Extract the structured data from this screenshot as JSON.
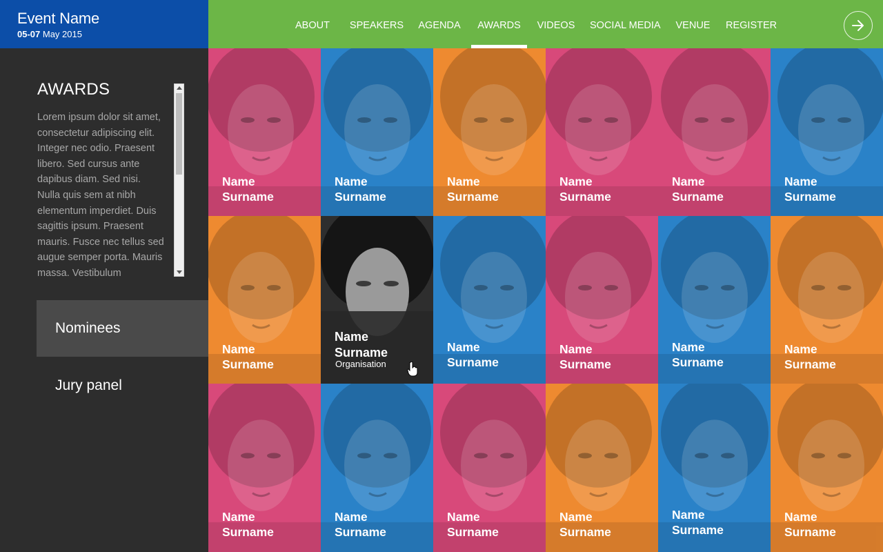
{
  "header": {
    "event_name": "Event Name",
    "date_bold": "05-07",
    "date_rest": " May 2015",
    "brand_color": "#0c4ea8",
    "bar_color": "#6cb647"
  },
  "nav": {
    "items": [
      {
        "label": "ABOUT"
      },
      {
        "label": "SPEAKERS"
      },
      {
        "label": "AGENDA"
      },
      {
        "label": "AWARDS",
        "active": true
      },
      {
        "label": "VIDEOS"
      },
      {
        "label": "SOCIAL MEDIA"
      },
      {
        "label": "VENUE"
      },
      {
        "label": "REGISTER"
      }
    ],
    "next_icon": "arrow-right-icon"
  },
  "sidebar": {
    "title": "AWARDS",
    "text": "Lorem ipsum dolor sit amet, consectetur adipiscing elit. Integer nec odio. Praesent libero. Sed cursus ante dapibus diam. Sed nisi. Nulla quis sem at nibh elementum imperdiet. Duis sagittis ipsum. Praesent mauris. Fusce nec tellus sed augue semper porta. Mauris massa. Vestibulum",
    "menu": [
      {
        "label": "Nominees",
        "selected": true
      },
      {
        "label": "Jury panel",
        "selected": false
      }
    ]
  },
  "colors": {
    "pink": "#d8497a",
    "blue": "#2a82c8",
    "orange": "#ee8a30"
  },
  "grid": {
    "tiles": [
      {
        "first": "Name",
        "last": "Surname",
        "color": "#d8497a"
      },
      {
        "first": "Name",
        "last": "Surname",
        "color": "#2a82c8"
      },
      {
        "first": "Name",
        "last": "Surname",
        "color": "#ee8a30"
      },
      {
        "first": "Name",
        "last": "Surname",
        "color": "#d8497a"
      },
      {
        "first": "Name",
        "last": "Surname",
        "color": "#d8497a"
      },
      {
        "first": "Name",
        "last": "Surname",
        "color": "#2a82c8"
      },
      {
        "first": "Name",
        "last": "Surname",
        "color": "#ee8a30"
      },
      {
        "first": "Name",
        "last": "Surname",
        "organisation": "Organisation",
        "featured": true
      },
      {
        "first": "Name",
        "last": "Surname",
        "color": "#2a82c8"
      },
      {
        "first": "Name",
        "last": "Surname",
        "color": "#d8497a"
      },
      {
        "first": "Name",
        "last": "Surname",
        "color": "#2a82c8"
      },
      {
        "first": "Name",
        "last": "Surname",
        "color": "#ee8a30"
      },
      {
        "first": "Name",
        "last": "Surname",
        "color": "#d8497a"
      },
      {
        "first": "Name",
        "last": "Surname",
        "color": "#2a82c8"
      },
      {
        "first": "Name",
        "last": "Surname",
        "color": "#d8497a"
      },
      {
        "first": "Name",
        "last": "Surname",
        "color": "#ee8a30"
      },
      {
        "first": "Name",
        "last": "Surname",
        "color": "#2a82c8"
      },
      {
        "first": "Name",
        "last": "Surname",
        "color": "#ee8a30"
      }
    ]
  }
}
